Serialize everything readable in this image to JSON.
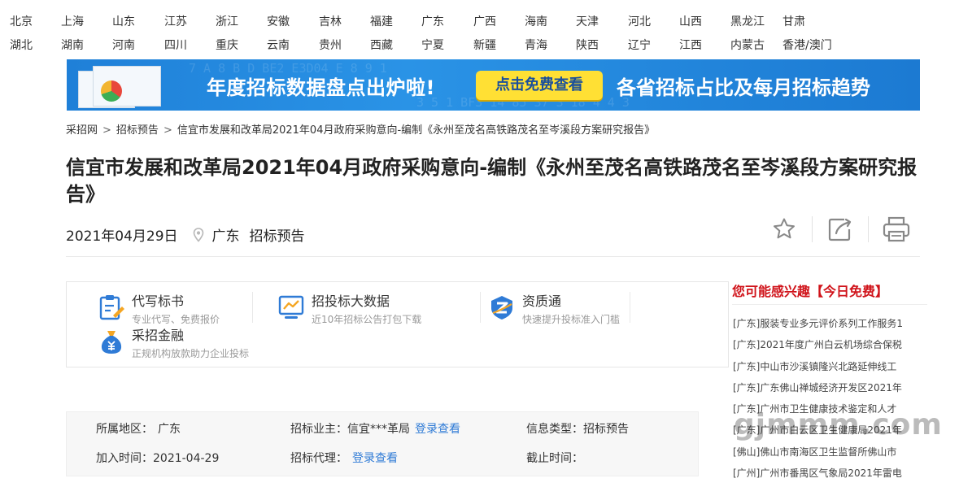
{
  "provinces_row1": [
    "北京",
    "上海",
    "山东",
    "江苏",
    "浙江",
    "安徽",
    "吉林",
    "福建",
    "广东",
    "广西",
    "海南",
    "天津",
    "河北",
    "山西",
    "黑龙江",
    "甘肃"
  ],
  "provinces_row2": [
    "湖北",
    "湖南",
    "河南",
    "四川",
    "重庆",
    "云南",
    "贵州",
    "西藏",
    "宁夏",
    "新疆",
    "青海",
    "陕西",
    "辽宁",
    "江西",
    "内蒙古",
    "香港/澳门"
  ],
  "banner": {
    "title": "年度招标数据盘点出炉啦!",
    "button": "点击免费查看",
    "right_text": "各省招标占比及每月招标趋势",
    "bg_text_1": "7 A 8   B   D  BE2  E3D04  E 8 9 1",
    "bg_text_2": "3 5 1  BF3  14  85  37 3  18 4 4 3"
  },
  "breadcrumb": {
    "home": "采招网",
    "section": "招标预告",
    "current": "信宜市发展和改革局2021年04月政府采购意向-编制《永州至茂名高铁路茂名至岑溪段方案研究报告》",
    "separator": ">"
  },
  "page_title": "信宜市发展和改革局2021年04月政府采购意向-编制《永州至茂名高铁路茂名至岑溪段方案研究报告》",
  "meta": {
    "date": "2021年04月29日",
    "region": "广东",
    "category": "招标预告"
  },
  "icons": {
    "pin": "location-pin-icon",
    "star": "star-icon",
    "edit": "edit-icon",
    "print": "print-icon"
  },
  "services": [
    {
      "title": "代写标书",
      "desc": "专业代写、免费报价",
      "icon": "document-edit-icon"
    },
    {
      "title": "招投标大数据",
      "desc": "近10年招标公告打包下载",
      "icon": "monitor-chart-icon"
    },
    {
      "title": "资质通",
      "desc": "快速提升投标准入门槛",
      "icon": "badge-z-icon"
    },
    {
      "title": "采招金融",
      "desc": "正规机构放款助力企业投标",
      "icon": "money-bag-icon"
    }
  ],
  "info": {
    "region_label": "所属地区：",
    "region_value": "广东",
    "owner_label": "招标业主：",
    "owner_value": "信宜***革局",
    "owner_link": "登录查看",
    "type_label": "信息类型：",
    "type_value": "招标预告",
    "added_label": "加入时间：",
    "added_value": "2021-04-29",
    "agent_label": "招标代理：",
    "agent_link": "登录查看",
    "deadline_label": "截止时间："
  },
  "sidebar": {
    "title": "您可能感兴趣【今日免费】",
    "items": [
      "[广东]服装专业多元评价系列工作服务1",
      "[广东]2021年度广州白云机场综合保税",
      "[广东]中山市沙溪镇隆兴北路延伸线工",
      "[广东]广东佛山禅城经济开发区2021年",
      "[广东]广州市卫生健康技术鉴定和人才",
      "[广东]广州市白云区卫生健康局2021年",
      "[佛山]佛山市南海区卫生监督所佛山市",
      "[广州]广州市番禺区气象局2021年雷电"
    ]
  },
  "watermark": "gjmmm.com",
  "colors": {
    "banner_blue": "#2a93e6",
    "banner_button": "#ffe034",
    "sidebar_title_red": "#d0131a",
    "link_blue": "#2f7bd6"
  }
}
